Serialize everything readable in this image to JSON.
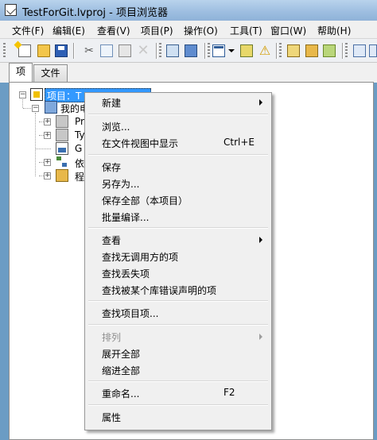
{
  "window": {
    "title": "TestForGit.lvproj - 项目浏览器"
  },
  "menubar": {
    "items": [
      "文件(F)",
      "编辑(E)",
      "查看(V)",
      "项目(P)",
      "操作(O)",
      "工具(T)",
      "窗口(W)",
      "帮助(H)"
    ]
  },
  "tabs": {
    "items": [
      "项",
      "文件"
    ],
    "active": "项"
  },
  "tree": {
    "project_label": "项目：TestForGit.lvproj",
    "project_label_visible": "项目：T",
    "computer_label_visible": "我的电",
    "items_visible": [
      "Pr",
      "Ty",
      "G",
      "依",
      "程"
    ]
  },
  "context_menu": {
    "items": [
      {
        "label": "新建",
        "submenu": true
      },
      {
        "label": "浏览..."
      },
      {
        "label": "在文件视图中显示",
        "shortcut": "Ctrl+E"
      },
      {
        "label": "保存"
      },
      {
        "label": "另存为..."
      },
      {
        "label": "保存全部（本项目）"
      },
      {
        "label": "批量编译..."
      },
      {
        "label": "查看",
        "submenu": true
      },
      {
        "label": "查找无调用方的项"
      },
      {
        "label": "查找丢失项"
      },
      {
        "label": "查找被某个库错误声明的项"
      },
      {
        "label": "查找项目项..."
      },
      {
        "label": "排列",
        "submenu": true,
        "disabled": true
      },
      {
        "label": "展开全部"
      },
      {
        "label": "缩进全部"
      },
      {
        "label": "重命名...",
        "shortcut": "F2"
      },
      {
        "label": "属性"
      }
    ]
  },
  "colors": {
    "selection": "#3399ff",
    "menu_bg": "#f0f0f0",
    "titlebar": "#9cbde0",
    "disabled_text": "#8d8d8d"
  },
  "toolbar": {
    "icons": [
      "new-vi-icon",
      "open-icon",
      "save-all-icon",
      "cut-icon",
      "copy-icon",
      "paste-icon",
      "delete-icon",
      "project-icon",
      "build-icon",
      "view-menu-icon",
      "resolve-icon",
      "warning-icon",
      "library-icon",
      "class-icon",
      "package-icon",
      "gen-icon"
    ]
  }
}
